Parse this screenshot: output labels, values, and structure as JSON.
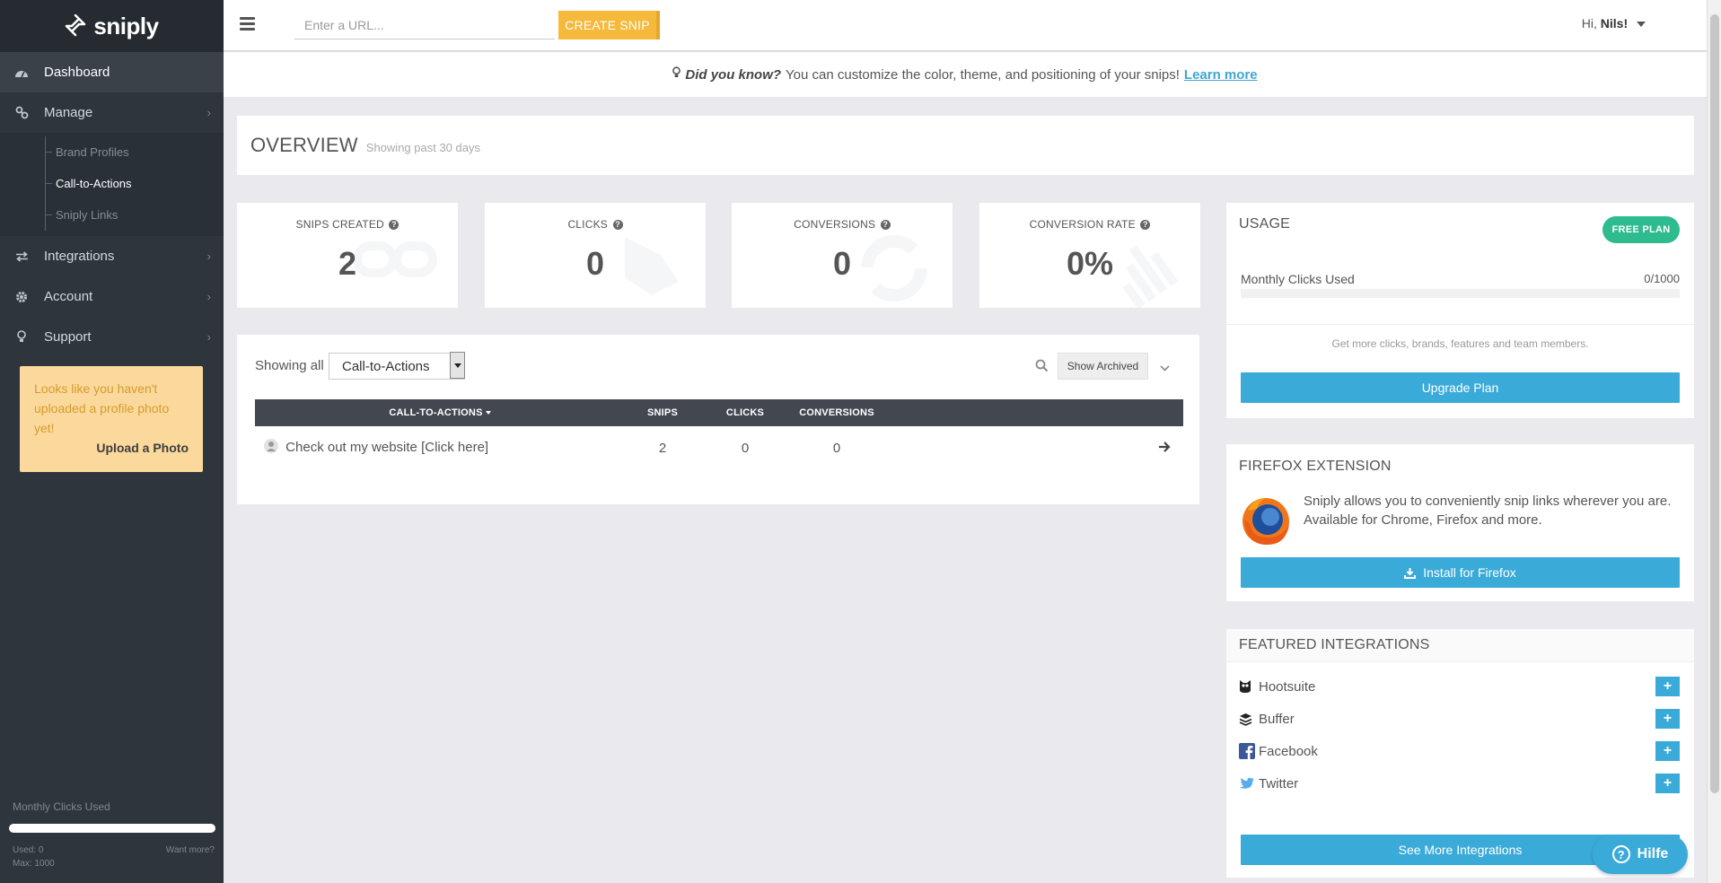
{
  "brand": {
    "name": "sniply"
  },
  "sidebar": {
    "items": [
      {
        "label": "Dashboard",
        "icon": "dashboard-icon"
      },
      {
        "label": "Manage",
        "icon": "link-icon"
      },
      {
        "label": "Integrations",
        "icon": "exchange-icon"
      },
      {
        "label": "Account",
        "icon": "gear-icon"
      },
      {
        "label": "Support",
        "icon": "lightbulb-icon"
      }
    ],
    "subitems": [
      "Brand Profiles",
      "Call-to-Actions",
      "Sniply Links"
    ],
    "photo_notice": "Looks like you haven't uploaded a profile photo yet!",
    "upload_label": "Upload a Photo",
    "monthly_title": "Monthly Clicks Used",
    "used": "Used: 0",
    "max": "Max: 1000",
    "want_more": "Want more?",
    "usage_fraction": 0.0
  },
  "topbar": {
    "url_placeholder": "Enter a URL...",
    "create_label": "CREATE SNIP",
    "greeting": "Hi,",
    "user": "Nils!"
  },
  "tip": {
    "lead": "Did you know?",
    "text": "You can customize the color, theme, and positioning of your snips!",
    "link": "Learn more"
  },
  "overview": {
    "title": "OVERVIEW",
    "subtitle": "Showing past 30 days"
  },
  "stats": [
    {
      "label": "SNIPS CREATED",
      "value": "2"
    },
    {
      "label": "CLICKS",
      "value": "0"
    },
    {
      "label": "CONVERSIONS",
      "value": "0"
    },
    {
      "label": "CONVERSION RATE",
      "value": "0%"
    }
  ],
  "cta": {
    "showing": "Showing all",
    "selected": "Call-to-Actions",
    "archived_label": "Show Archived",
    "columns": [
      "CALL-TO-ACTIONS",
      "SNIPS",
      "CLICKS",
      "CONVERSIONS"
    ],
    "rows": [
      {
        "name": "Check out my website [Click here]",
        "snips": "2",
        "clicks": "0",
        "conversions": "0"
      }
    ]
  },
  "usage": {
    "title": "USAGE",
    "plan": "FREE PLAN",
    "monthly_label": "Monthly Clicks Used",
    "monthly_value": "0/1000",
    "get_more": "Get more clicks, brands, features and team members.",
    "upgrade_label": "Upgrade Plan"
  },
  "firefox": {
    "title": "FIREFOX EXTENSION",
    "desc": "Sniply allows you to conveniently snip links wherever you are. Available for Chrome, Firefox and more.",
    "install_label": "Install for Firefox"
  },
  "integrations": {
    "title": "FEATURED INTEGRATIONS",
    "items": [
      {
        "label": "Hootsuite",
        "icon": "owl-icon"
      },
      {
        "label": "Buffer",
        "icon": "stack-icon"
      },
      {
        "label": "Facebook",
        "icon": "facebook-icon"
      },
      {
        "label": "Twitter",
        "icon": "twitter-icon"
      }
    ],
    "see_more": "See More Integrations"
  },
  "help": {
    "label": "Hilfe"
  },
  "colors": {
    "accent": "#3aabd8",
    "sidebar": "#2f353d",
    "create": "#f5b93b",
    "free": "#2ebb8f"
  }
}
